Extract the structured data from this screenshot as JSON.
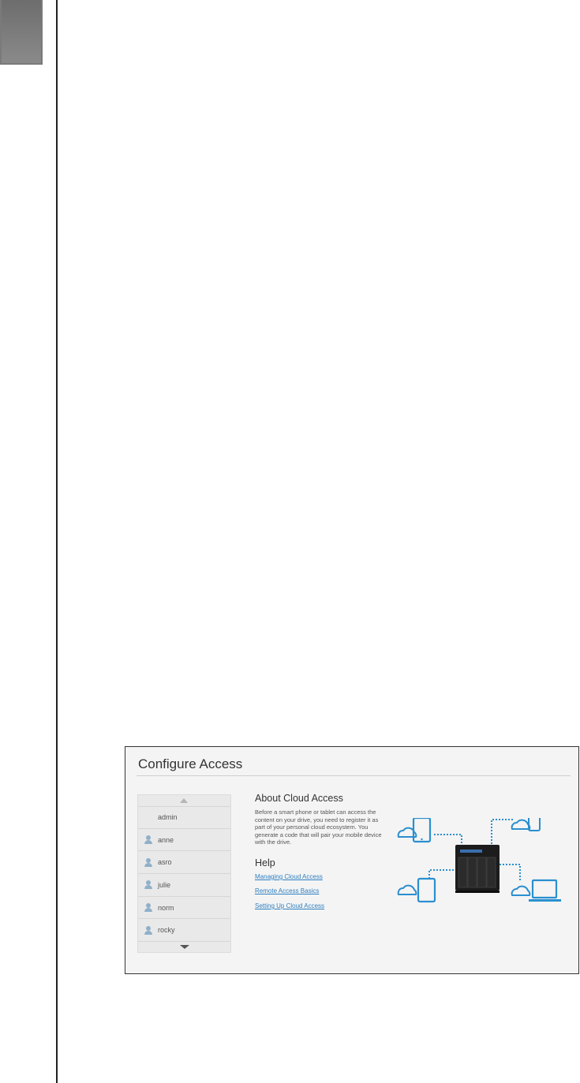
{
  "screen": {
    "title": "Configure Access",
    "user_list": {
      "users": [
        {
          "name": "admin",
          "icon": "none"
        },
        {
          "name": "anne",
          "icon": "user-icon"
        },
        {
          "name": "asro",
          "icon": "user-icon"
        },
        {
          "name": "julie",
          "icon": "user-icon"
        },
        {
          "name": "norm",
          "icon": "user-icon"
        },
        {
          "name": "rocky",
          "icon": "user-icon"
        }
      ]
    },
    "about": {
      "heading": "About Cloud Access",
      "text": "Before a smart phone or tablet can access the content on your drive, you need to register it as part of your personal cloud ecosystem. You generate a code that will pair your mobile device with the drive."
    },
    "help": {
      "heading": "Help",
      "links": [
        "Managing Cloud Access",
        "Remote Access Basics",
        "Setting Up Cloud Access"
      ]
    },
    "colors": {
      "accent": "#2a8fd0",
      "link": "#2f7fc1",
      "panel_bg": "#f4f4f4"
    }
  }
}
